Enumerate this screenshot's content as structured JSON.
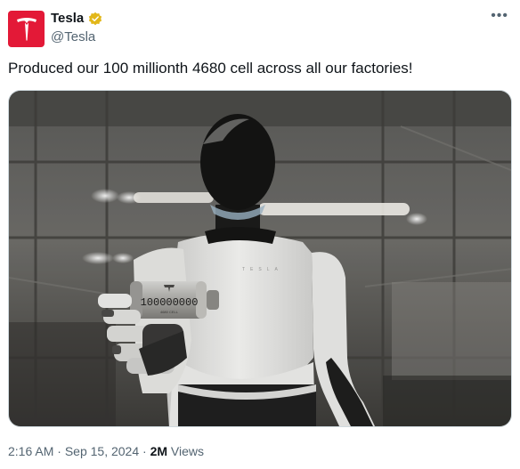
{
  "author": {
    "name": "Tesla",
    "handle": "@Tesla",
    "verified_color": "#e2b719",
    "brand_color": "#e31937",
    "avatar_icon": "tesla-logo-icon"
  },
  "menu_icon": "more-options-icon",
  "tweet": {
    "text": "Produced our 100 millionth 4680 cell across all our factories!"
  },
  "media": {
    "cell_label": "100000000",
    "cell_sublabel": "4680 CELL"
  },
  "meta": {
    "time": "2:16 AM",
    "separator": "·",
    "date": "Sep 15, 2024",
    "views_count": "2M",
    "views_label": "Views"
  }
}
